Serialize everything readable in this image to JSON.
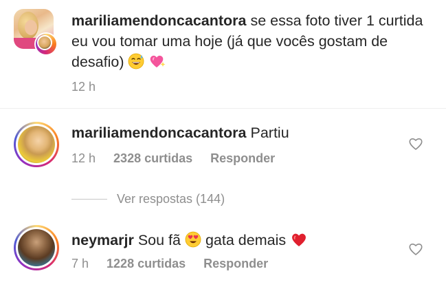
{
  "caption": {
    "username": "mariliamendoncacantora",
    "text": "se essa foto tiver 1 curtida eu vou tomar uma hoje (já que vocês gostam de desafio)",
    "emojis": [
      "grinning-sweat",
      "sparkling-heart"
    ],
    "time": "12 h"
  },
  "comments": [
    {
      "username": "mariliamendoncacantora",
      "text": "Partiu",
      "time": "12 h",
      "likes": "2328 curtidas",
      "reply": "Responder"
    },
    {
      "username": "neymarjr",
      "text_before": "Sou fã",
      "text_after": "gata demais",
      "emojis": [
        "heart-eyes",
        "red-heart"
      ],
      "time": "7 h",
      "likes": "1228 curtidas",
      "reply": "Responder"
    }
  ],
  "view_replies": "Ver respostas (144)",
  "colors": {
    "text": "#262626",
    "secondary": "#8e8e8e",
    "divider": "#efefef",
    "heart": "#ed4956"
  },
  "icons": {
    "like": "heart-outline-icon"
  }
}
